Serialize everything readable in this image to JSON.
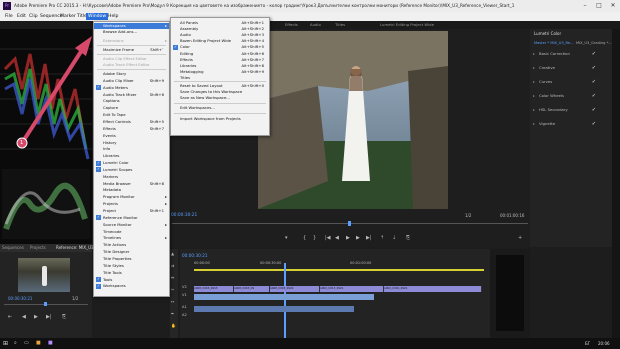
{
  "window": {
    "title": "Adobe Premiere Pro CC 2015.3 - H:\\Курсове\\Adobe Premiere Pro\\Модул 9 Корекция на цветовете на изображението - колор градинг\\Урок3 Допълнителни контролни монитори (Reference Monitor)\\MIX_U3_Reference_Viewer_Start_1",
    "app_icon": "Pr"
  },
  "menubar": [
    "File",
    "Edit",
    "Clip",
    "Sequence",
    "Marker",
    "Title",
    "Window",
    "Help"
  ],
  "workspace_tabs": [
    "Effects",
    "Audio",
    "Titles",
    "Lumetri Editing Project Wide"
  ],
  "window_menu": {
    "top": [
      {
        "label": "Workspaces",
        "hl": true,
        "arrow": true
      },
      {
        "label": "Browse Add-ons..."
      },
      {
        "label": "Extensions",
        "dis": true,
        "arrow": true
      }
    ],
    "mid": [
      {
        "label": "Maximize Frame",
        "sc": "Shift+`"
      },
      {
        "label": "Audio Clip Effect Editor",
        "dis": true
      },
      {
        "label": "Audio Track Effect Editor",
        "dis": true
      }
    ],
    "items": [
      {
        "label": "Adobe Story"
      },
      {
        "label": "Audio Clip Mixer",
        "sc": "Shift+9"
      },
      {
        "label": "Audio Meters",
        "ck": true
      },
      {
        "label": "Audio Track Mixer",
        "sc": "Shift+6"
      },
      {
        "label": "Captions"
      },
      {
        "label": "Capture"
      },
      {
        "label": "Edit To Tape"
      },
      {
        "label": "Effect Controls",
        "sc": "Shift+5"
      },
      {
        "label": "Effects",
        "sc": "Shift+7"
      },
      {
        "label": "Events"
      },
      {
        "label": "History"
      },
      {
        "label": "Info"
      },
      {
        "label": "Libraries"
      },
      {
        "label": "Lumetri Color",
        "ck": true
      },
      {
        "label": "Lumetri Scopes",
        "ck": true
      },
      {
        "label": "Markers"
      },
      {
        "label": "Media Browser",
        "sc": "Shift+8"
      },
      {
        "label": "Metadata"
      },
      {
        "label": "Program Monitor",
        "arrow": true
      },
      {
        "label": "Projects",
        "arrow": true
      },
      {
        "label": "Project",
        "sc": "Shift+1"
      },
      {
        "label": "Reference Monitor",
        "ck": true
      },
      {
        "label": "Source Monitor",
        "arrow": true
      },
      {
        "label": "Timecode"
      },
      {
        "label": "Timelines",
        "arrow": true
      },
      {
        "label": "Title Actions"
      },
      {
        "label": "Title Designer"
      },
      {
        "label": "Title Properties"
      },
      {
        "label": "Title Styles"
      },
      {
        "label": "Title Tools"
      },
      {
        "label": "Tools",
        "ck": true
      },
      {
        "label": "Workspaces",
        "ck": true
      }
    ]
  },
  "workspaces_menu": {
    "items": [
      {
        "label": "All Panels",
        "sc": "Alt+Shift+1"
      },
      {
        "label": "Assembly",
        "sc": "Alt+Shift+2"
      },
      {
        "label": "Audio",
        "sc": "Alt+Shift+3"
      },
      {
        "label": "Bozen Editing Project Wide",
        "sc": "Alt+Shift+4"
      },
      {
        "label": "Color",
        "sc": "Alt+Shift+5",
        "ck": true
      },
      {
        "label": "Editing",
        "sc": "Alt+Shift+6"
      },
      {
        "label": "Effects",
        "sc": "Alt+Shift+7"
      },
      {
        "label": "Libraries",
        "sc": "Alt+Shift+8"
      },
      {
        "label": "Metalogging",
        "sc": "Alt+Shift+9"
      },
      {
        "label": "Titles"
      }
    ],
    "reset": [
      {
        "label": "Reset to Saved Layout",
        "sc": "Alt+Shift+0"
      },
      {
        "label": "Save Changes to this Workspace"
      },
      {
        "label": "Save as New Workspace..."
      }
    ],
    "edit": "Edit Workspaces...",
    "import": "Import Workspace from Projects"
  },
  "program_monitor": {
    "timecode_left": "00:00:30:21",
    "timecode_right": "00:01:00:16",
    "fit": "1/2",
    "timeline_tc": "00:00:30:21",
    "timeline_marks": [
      "00:00:00",
      "00:00:30:00",
      "00:01:00:00"
    ]
  },
  "source_panel": {
    "tabs": [
      "Sequences",
      "Projects",
      "Reference: MIX_U3_Re"
    ],
    "timecode": "00:00:30:21",
    "fit": "1/2"
  },
  "lumetri": {
    "title": "Lumetri Color",
    "source": "Master * MIX_U3_Re...",
    "clip": "MIX_U3_Grading *...",
    "sections": [
      "Basic Correction",
      "Creative",
      "Curves",
      "Color Wheels",
      "HSL Secondary",
      "Vignette"
    ]
  },
  "clips": [
    "A008_C003_0913",
    "A008_C003_09",
    "A008_C003_0922",
    "A004_C013_0921",
    "A004_C001_0921"
  ],
  "track_labels": [
    "V2",
    "V1",
    "A1",
    "A2"
  ],
  "annotation": {
    "step": "1"
  },
  "taskbar": {
    "time": "20:06",
    "lang": "БГ"
  },
  "colors": {
    "accent": "#3d7bd9",
    "menu_bg": "#f2f2f2",
    "annotation": "#d6496a",
    "clip_video": "#8d8ad8",
    "clip_audio": "#7a9fd6"
  }
}
